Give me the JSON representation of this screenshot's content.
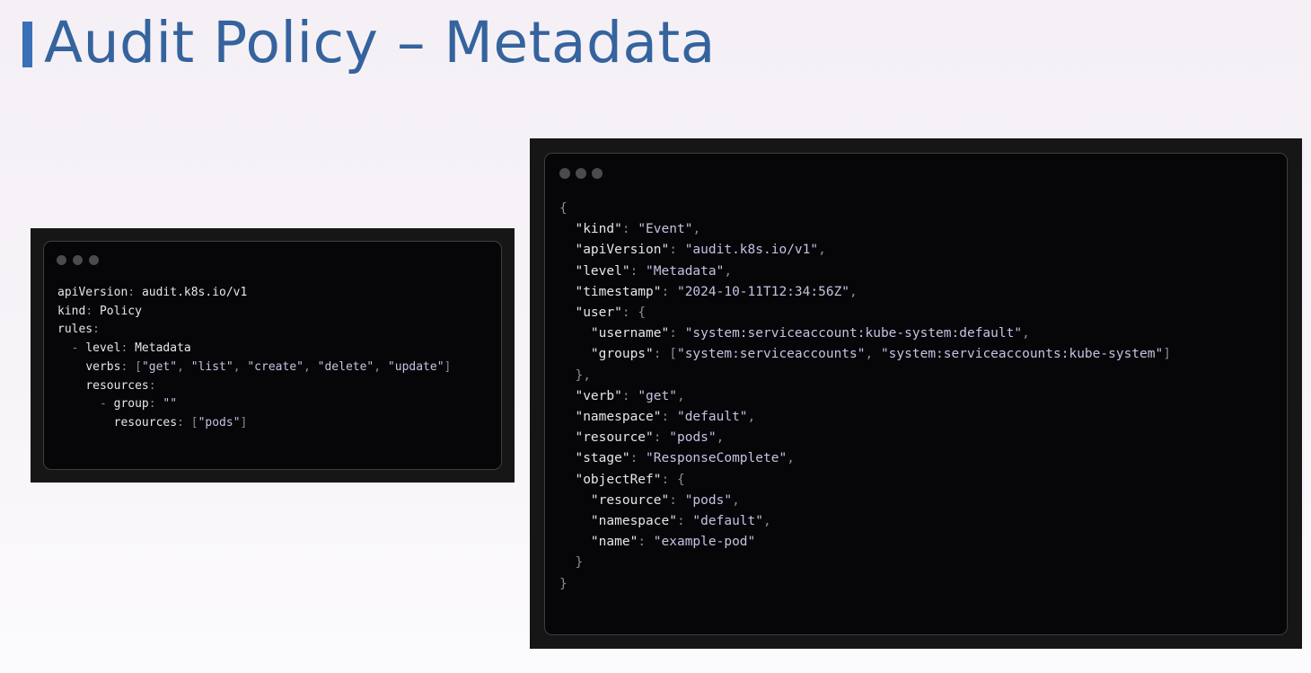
{
  "slide": {
    "title": "Audit Policy – Metadata"
  },
  "policy_yaml": {
    "lines": [
      [
        [
          "k",
          "apiVersion"
        ],
        [
          "p",
          ": "
        ],
        [
          "k",
          "audit.k8s.io/v1"
        ]
      ],
      [
        [
          "k",
          "kind"
        ],
        [
          "p",
          ": "
        ],
        [
          "k",
          "Policy"
        ]
      ],
      [
        [
          "k",
          "rules"
        ],
        [
          "p",
          ":"
        ]
      ],
      [
        [
          "p",
          "  - "
        ],
        [
          "k",
          "level"
        ],
        [
          "p",
          ": "
        ],
        [
          "k",
          "Metadata"
        ]
      ],
      [
        [
          "p",
          "    "
        ],
        [
          "k",
          "verbs"
        ],
        [
          "p",
          ": ["
        ],
        [
          "v",
          "\"get\""
        ],
        [
          "p",
          ", "
        ],
        [
          "v",
          "\"list\""
        ],
        [
          "p",
          ", "
        ],
        [
          "v",
          "\"create\""
        ],
        [
          "p",
          ", "
        ],
        [
          "v",
          "\"delete\""
        ],
        [
          "p",
          ", "
        ],
        [
          "v",
          "\"update\""
        ],
        [
          "p",
          "]"
        ]
      ],
      [
        [
          "p",
          "    "
        ],
        [
          "k",
          "resources"
        ],
        [
          "p",
          ":"
        ]
      ],
      [
        [
          "p",
          "      - "
        ],
        [
          "k",
          "group"
        ],
        [
          "p",
          ": "
        ],
        [
          "v",
          "\"\""
        ]
      ],
      [
        [
          "p",
          "        "
        ],
        [
          "k",
          "resources"
        ],
        [
          "p",
          ": ["
        ],
        [
          "v",
          "\"pods\""
        ],
        [
          "p",
          "]"
        ]
      ]
    ]
  },
  "event_json": {
    "lines": [
      [
        [
          "p",
          "{"
        ]
      ],
      [
        [
          "p",
          "  "
        ],
        [
          "k",
          "\"kind\""
        ],
        [
          "p",
          ": "
        ],
        [
          "v",
          "\"Event\""
        ],
        [
          "p",
          ","
        ]
      ],
      [
        [
          "p",
          "  "
        ],
        [
          "k",
          "\"apiVersion\""
        ],
        [
          "p",
          ": "
        ],
        [
          "v",
          "\"audit.k8s.io/v1\""
        ],
        [
          "p",
          ","
        ]
      ],
      [
        [
          "p",
          "  "
        ],
        [
          "k",
          "\"level\""
        ],
        [
          "p",
          ": "
        ],
        [
          "v",
          "\"Metadata\""
        ],
        [
          "p",
          ","
        ]
      ],
      [
        [
          "p",
          "  "
        ],
        [
          "k",
          "\"timestamp\""
        ],
        [
          "p",
          ": "
        ],
        [
          "v",
          "\"2024-10-11T12:34:56Z\""
        ],
        [
          "p",
          ","
        ]
      ],
      [
        [
          "p",
          "  "
        ],
        [
          "k",
          "\"user\""
        ],
        [
          "p",
          ": {"
        ]
      ],
      [
        [
          "p",
          "    "
        ],
        [
          "k",
          "\"username\""
        ],
        [
          "p",
          ": "
        ],
        [
          "v",
          "\"system:serviceaccount:kube-system:default\""
        ],
        [
          "p",
          ","
        ]
      ],
      [
        [
          "p",
          "    "
        ],
        [
          "k",
          "\"groups\""
        ],
        [
          "p",
          ": ["
        ],
        [
          "v",
          "\"system:serviceaccounts\""
        ],
        [
          "p",
          ", "
        ],
        [
          "v",
          "\"system:serviceaccounts:kube-system\""
        ],
        [
          "p",
          "]"
        ]
      ],
      [
        [
          "p",
          "  },"
        ]
      ],
      [
        [
          "p",
          "  "
        ],
        [
          "k",
          "\"verb\""
        ],
        [
          "p",
          ": "
        ],
        [
          "v",
          "\"get\""
        ],
        [
          "p",
          ","
        ]
      ],
      [
        [
          "p",
          "  "
        ],
        [
          "k",
          "\"namespace\""
        ],
        [
          "p",
          ": "
        ],
        [
          "v",
          "\"default\""
        ],
        [
          "p",
          ","
        ]
      ],
      [
        [
          "p",
          "  "
        ],
        [
          "k",
          "\"resource\""
        ],
        [
          "p",
          ": "
        ],
        [
          "v",
          "\"pods\""
        ],
        [
          "p",
          ","
        ]
      ],
      [
        [
          "p",
          "  "
        ],
        [
          "k",
          "\"stage\""
        ],
        [
          "p",
          ": "
        ],
        [
          "v",
          "\"ResponseComplete\""
        ],
        [
          "p",
          ","
        ]
      ],
      [
        [
          "p",
          "  "
        ],
        [
          "k",
          "\"objectRef\""
        ],
        [
          "p",
          ": {"
        ]
      ],
      [
        [
          "p",
          "    "
        ],
        [
          "k",
          "\"resource\""
        ],
        [
          "p",
          ": "
        ],
        [
          "v",
          "\"pods\""
        ],
        [
          "p",
          ","
        ]
      ],
      [
        [
          "p",
          "    "
        ],
        [
          "k",
          "\"namespace\""
        ],
        [
          "p",
          ": "
        ],
        [
          "v",
          "\"default\""
        ],
        [
          "p",
          ","
        ]
      ],
      [
        [
          "p",
          "    "
        ],
        [
          "k",
          "\"name\""
        ],
        [
          "p",
          ": "
        ],
        [
          "v",
          "\"example-pod\""
        ]
      ],
      [
        [
          "p",
          "  }"
        ]
      ],
      [
        [
          "p",
          "}"
        ]
      ]
    ]
  }
}
